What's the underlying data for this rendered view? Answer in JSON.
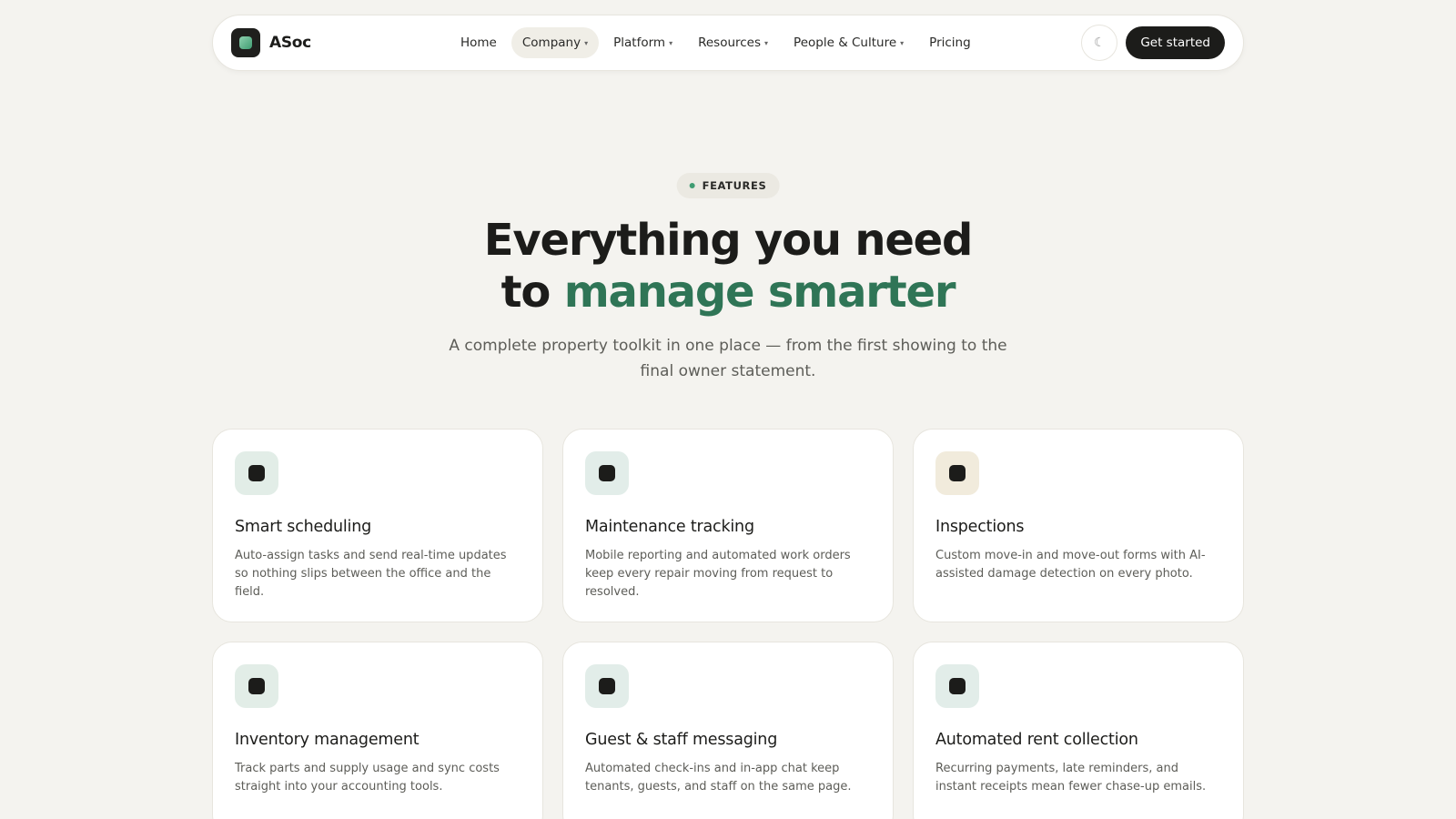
{
  "brand": {
    "name": "ASoc",
    "logo_icon": "app-logo-icon"
  },
  "nav": {
    "items": [
      {
        "label": "Home",
        "dropdown": false,
        "active": false
      },
      {
        "label": "Company",
        "dropdown": true,
        "active": true
      },
      {
        "label": "Platform",
        "dropdown": true,
        "active": false
      },
      {
        "label": "Resources",
        "dropdown": true,
        "active": false
      },
      {
        "label": "People & Culture",
        "dropdown": true,
        "active": false
      },
      {
        "label": "Pricing",
        "dropdown": false,
        "active": false
      }
    ],
    "caret": "▾",
    "theme_toggle_glyph": "☾",
    "cta_label": "Get started"
  },
  "hero": {
    "badge": "FEATURES",
    "headline_line1": "Everything you need",
    "headline_line2_prefix": "to ",
    "headline_line2_accent": "manage smarter",
    "subtitle": "A complete property toolkit in one place — from the first showing to the final owner statement."
  },
  "features": [
    {
      "title": "Smart scheduling",
      "desc": "Auto-assign tasks and send real-time updates so nothing slips between the office and the field.",
      "icon_bg": "#e2ede7"
    },
    {
      "title": "Maintenance tracking",
      "desc": "Mobile reporting and automated work orders keep every repair moving from request to resolved.",
      "icon_bg": "#e2ede9"
    },
    {
      "title": "Inspections",
      "desc": "Custom move-in and move-out forms with AI-assisted damage detection on every photo.",
      "icon_bg": "#f1ebdc"
    },
    {
      "title": "Inventory management",
      "desc": "Track parts and supply usage and sync costs straight into your accounting tools.",
      "icon_bg": "#e2ede7"
    },
    {
      "title": "Guest & staff messaging",
      "desc": "Automated check-ins and in-app chat keep tenants, guests, and staff on the same page.",
      "icon_bg": "#e2ede9"
    },
    {
      "title": "Automated rent collection",
      "desc": "Recurring payments, late reminders, and instant receipts mean fewer chase-up emails.",
      "icon_bg": "#e2ede9"
    }
  ],
  "colors": {
    "accent": "#2f7556",
    "background": "#f4f3ef",
    "dark": "#1c1c1a"
  }
}
